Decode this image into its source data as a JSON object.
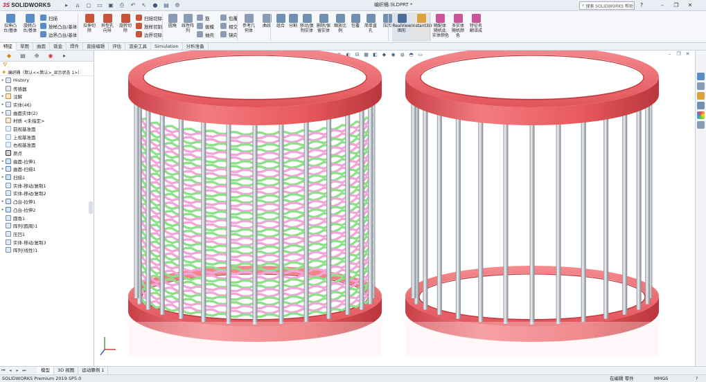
{
  "title_bar": {
    "logo_ds": "3S",
    "logo_text": "SOLIDWORKS",
    "document_title": "编织桶.SLDPRT *",
    "search_placeholder": "搜索 SOLIDWORKS 帮助",
    "window_controls": [
      "minimize-icon",
      "restore-icon",
      "close-icon"
    ]
  },
  "ribbon": {
    "features": [
      {
        "label": "拉伸凸\n台/基体",
        "color": "#5a8cc8"
      },
      {
        "label": "旋转凸\n台/基体",
        "color": "#5a8cc8"
      },
      {
        "label": "扫描",
        "color": "#5a8cc8"
      },
      {
        "label": "放样凸台/基体",
        "color": "#5a8cc8"
      },
      {
        "label": "边界凸台/基体",
        "color": "#5a8cc8"
      },
      {
        "label": "拉伸切\n除",
        "color": "#c8553a"
      },
      {
        "label": "异型孔\n向导",
        "color": "#c8553a"
      },
      {
        "label": "旋转切\n除",
        "color": "#c8553a"
      },
      {
        "label": "扫描切除",
        "color": "#c8553a"
      },
      {
        "label": "放样切割",
        "color": "#c8553a"
      },
      {
        "label": "边界切除",
        "color": "#c8553a"
      },
      {
        "label": "圆角",
        "color": "#8a9cb5"
      },
      {
        "label": "线性阵\n列",
        "color": "#8a9cb5"
      },
      {
        "label": "筋",
        "color": "#8a9cb5"
      },
      {
        "label": "拔模",
        "color": "#8a9cb5"
      },
      {
        "label": "抽壳",
        "color": "#8a9cb5"
      },
      {
        "label": "包覆",
        "color": "#8a9cb5"
      },
      {
        "label": "相交",
        "color": "#8a9cb5"
      },
      {
        "label": "镜向",
        "color": "#8a9cb5"
      },
      {
        "label": "参考几\n何体",
        "color": "#8a9cb5"
      },
      {
        "label": "曲线",
        "color": "#8a9cb5"
      },
      {
        "label": "组合",
        "color": "#6f8fb3"
      },
      {
        "label": "分割",
        "color": "#6f8fb3"
      },
      {
        "label": "移动/复\n制实体",
        "color": "#6f8fb3"
      },
      {
        "label": "删除/保\n留实体",
        "color": "#6f8fb3"
      },
      {
        "label": "缩放比\n例",
        "color": "#6f8fb3"
      },
      {
        "label": "包覆",
        "color": "#6f8fb3"
      },
      {
        "label": "简单直\n孔",
        "color": "#6f8fb3"
      },
      {
        "label": "压凹",
        "color": "#6f8fb3"
      },
      {
        "label": "RealView\n图形",
        "color": "#4a6e96"
      },
      {
        "label": "Instant3D",
        "color": "#d9a23a"
      },
      {
        "label": "随配体\n随机此\n实体颜色",
        "color": "#cc5599"
      },
      {
        "label": "多实体\n随机颜\n色",
        "color": "#cc5599"
      },
      {
        "label": "特征名\n翻译成",
        "color": "#cc5599"
      }
    ]
  },
  "command_tabs": [
    "特征",
    "草图",
    "曲面",
    "钣金",
    "焊件",
    "直接编辑",
    "评估",
    "渲染工具",
    "Simulation",
    "分析准备"
  ],
  "active_command_tab": 0,
  "feature_tree": {
    "root_label": "编织桶（默认<<默认>_显示状态 1>）",
    "items": [
      {
        "label": "History",
        "icon": "history-icon",
        "color": "#7a8a9c",
        "arrow": "▸"
      },
      {
        "label": "传感器",
        "icon": "sensor-icon",
        "color": "#7a8a9c",
        "arrow": ""
      },
      {
        "label": "注解",
        "icon": "annotation-icon",
        "color": "#c88a2a",
        "arrow": "▸"
      },
      {
        "label": "实体(46)",
        "icon": "solid-bodies-icon",
        "color": "#7a8a9c",
        "arrow": "▸"
      },
      {
        "label": "曲面实体(2)",
        "icon": "surface-bodies-icon",
        "color": "#7a8a9c",
        "arrow": "▸"
      },
      {
        "label": "材质 <未指定>",
        "icon": "material-icon",
        "color": "#b2895a",
        "arrow": ""
      },
      {
        "label": "前视基准面",
        "icon": "plane-icon",
        "color": "#8fb2d9",
        "arrow": ""
      },
      {
        "label": "上视基准面",
        "icon": "plane-icon",
        "color": "#8fb2d9",
        "arrow": ""
      },
      {
        "label": "右视基准面",
        "icon": "plane-icon",
        "color": "#8fb2d9",
        "arrow": ""
      },
      {
        "label": "原点",
        "icon": "origin-icon",
        "color": "#333333",
        "arrow": ""
      },
      {
        "label": "曲面-拉伸1",
        "icon": "surface-extrude-icon",
        "color": "#4d7fb8",
        "arrow": "▸"
      },
      {
        "label": "曲面-扫描1",
        "icon": "surface-sweep-icon",
        "color": "#4d7fb8",
        "arrow": "▸"
      },
      {
        "label": "扫描1",
        "icon": "sweep-icon",
        "color": "#4d7fb8",
        "arrow": "▸"
      },
      {
        "label": "实体-移动/复制1",
        "icon": "move-copy-icon",
        "color": "#6f8fb3",
        "arrow": ""
      },
      {
        "label": "实体-移动/复制2",
        "icon": "move-copy-icon",
        "color": "#6f8fb3",
        "arrow": ""
      },
      {
        "label": "凸台-拉伸1",
        "icon": "boss-extrude-icon",
        "color": "#4d7fb8",
        "arrow": "▸"
      },
      {
        "label": "凸台-拉伸2",
        "icon": "boss-extrude-icon",
        "color": "#4d7fb8",
        "arrow": "▸"
      },
      {
        "label": "圆角1",
        "icon": "fillet-icon",
        "color": "#6f8fb3",
        "arrow": ""
      },
      {
        "label": "阵列(圆周)1",
        "icon": "circular-pattern-icon",
        "color": "#6f8fb3",
        "arrow": ""
      },
      {
        "label": "压凹1",
        "icon": "indent-icon",
        "color": "#6f8fb3",
        "arrow": ""
      },
      {
        "label": "实体-移动/复制3",
        "icon": "move-copy-icon",
        "color": "#6f8fb3",
        "arrow": ""
      },
      {
        "label": "阵列(线性)1",
        "icon": "linear-pattern-icon",
        "color": "#6f8fb3",
        "arrow": ""
      }
    ]
  },
  "bottom_tabs": [
    "模型",
    "3D 视图",
    "运动算例 1"
  ],
  "active_bottom_tab": 0,
  "status_bar": {
    "left": "SOLIDWORKS Premium 2019 SP5.0",
    "mode": "在编辑 零件",
    "units": "MMGS"
  },
  "colors": {
    "ring": "#e8585c",
    "ring_dark": "#b8363c",
    "rod": "#aeb5bd",
    "strand_green": "#8ee08a",
    "strand_pink": "#f0a6d8",
    "accent": "#3a6ea8"
  }
}
